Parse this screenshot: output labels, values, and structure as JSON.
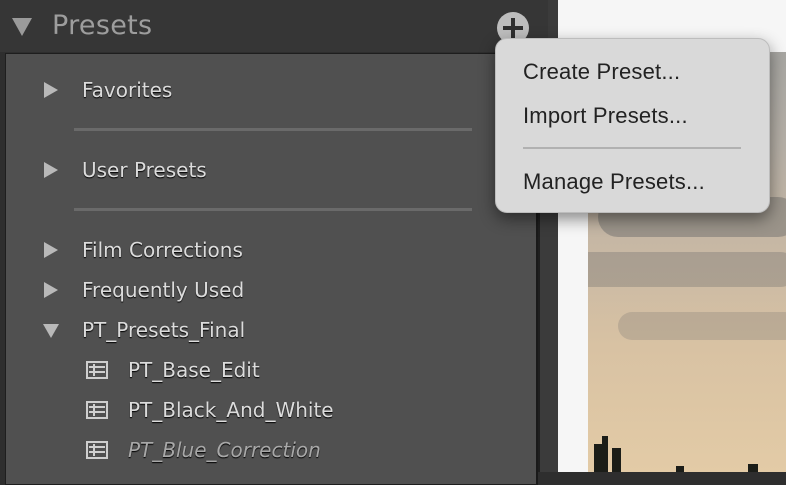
{
  "panel": {
    "title": "Presets",
    "add_icon": "plus-icon"
  },
  "groups": [
    {
      "label": "Favorites",
      "state": "collapsed"
    },
    {
      "label": "User Presets",
      "state": "collapsed"
    },
    {
      "label": "Film Corrections",
      "state": "collapsed"
    },
    {
      "label": "Frequently Used",
      "state": "collapsed"
    },
    {
      "label": "PT_Presets_Final",
      "state": "expanded"
    }
  ],
  "presets": [
    {
      "label": "PT_Base_Edit"
    },
    {
      "label": "PT_Black_And_White"
    },
    {
      "label": "PT_Blue_Correction"
    }
  ],
  "menu": {
    "items": [
      "Create Preset...",
      "Import Presets...",
      "Manage Presets..."
    ]
  }
}
